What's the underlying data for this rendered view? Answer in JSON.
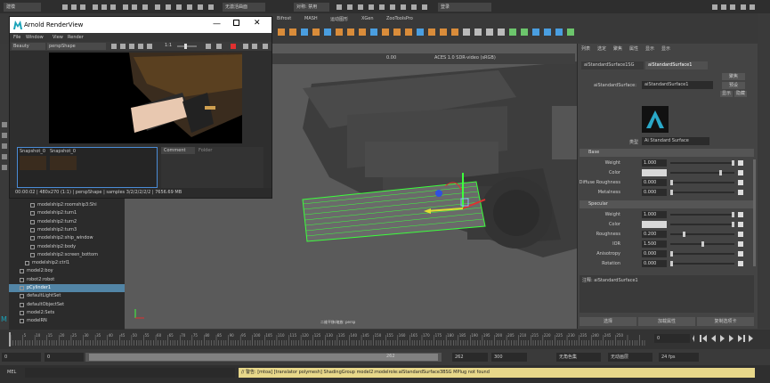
{
  "topbar": {
    "workspace": "建模",
    "no_live_surface": "无激活曲面",
    "symmetry": "对称: 禁用",
    "login": "登录"
  },
  "shelf_tabs": [
    "Bifrost",
    "MASH",
    "运动图形",
    "XGen",
    "ZooToolsPro"
  ],
  "render_view": {
    "title": "Arnold RenderView",
    "menu": [
      "File",
      "Window",
      "View",
      "Render"
    ],
    "aov": "Beauty",
    "camera": "perspShape",
    "ratio": "1:1",
    "exposure": "0.00",
    "color_space": "ACES 1.0 SDR-video (sRGB)",
    "snapshots": [
      "Snapshot_0",
      "Snapshot_0"
    ],
    "tabs": [
      "Comment",
      "Folder"
    ],
    "status": "00:00:02 | 480x270 (1:1) | perspShape | samples 3/2/2/2/2/2 | 7656.69 MB"
  },
  "viewport": {
    "camera_label": "二维平移/缩放: persp"
  },
  "outliner": {
    "items": [
      {
        "label": "modelship2:roomship3:Shi",
        "indent": 3,
        "selected": false
      },
      {
        "label": "modelship2:turn1",
        "indent": 3,
        "selected": false
      },
      {
        "label": "modelship2:turn2",
        "indent": 3,
        "selected": false
      },
      {
        "label": "modelship2:turn3",
        "indent": 3,
        "selected": false
      },
      {
        "label": "modelship2:ship_window",
        "indent": 3,
        "selected": false
      },
      {
        "label": "modelship2:body",
        "indent": 3,
        "selected": false
      },
      {
        "label": "modelship2:screen_bottom",
        "indent": 3,
        "selected": false
      },
      {
        "label": "modelship2:ctrl1",
        "indent": 2,
        "selected": false
      },
      {
        "label": "model2:boy",
        "indent": 1,
        "selected": false
      },
      {
        "label": "robot2:robot",
        "indent": 1,
        "selected": false
      },
      {
        "label": "pCylinder1",
        "indent": 1,
        "selected": true
      },
      {
        "label": "defaultLightSet",
        "indent": 1,
        "selected": false
      },
      {
        "label": "defaultObjectSet",
        "indent": 1,
        "selected": false
      },
      {
        "label": "model2:Sets",
        "indent": 1,
        "selected": false
      },
      {
        "label": "modelRN",
        "indent": 1,
        "selected": false
      }
    ]
  },
  "attr": {
    "top_tabs": [
      "列表",
      "选定",
      "聚焦",
      "属性",
      "显示",
      "显示"
    ],
    "node_tabs": [
      "aiStandardSurface1SG",
      "aiStandardSurface1"
    ],
    "node_label": "aiStandardSurface:",
    "node_name": "aiStandardSurface1",
    "focus_btn": "聚焦",
    "preset_btn": "预设",
    "show_btn": "显示",
    "hide_btn": "隐藏",
    "type_label": "类型",
    "type_value": "Ai Standard Surface",
    "base_section": "Base",
    "base_params": [
      {
        "label": "Weight",
        "value": "1.000",
        "level": 1.0
      },
      {
        "label": "Color",
        "value": "",
        "level": 0.8
      },
      {
        "label": "Diffuse Roughness",
        "value": "0.000",
        "level": 0.0
      },
      {
        "label": "Metalness",
        "value": "0.000",
        "level": 0.0
      }
    ],
    "spec_section": "Specular",
    "spec_params": [
      {
        "label": "Weight",
        "value": "1.000",
        "level": 1.0
      },
      {
        "label": "Color",
        "value": "",
        "level": 1.0
      },
      {
        "label": "Roughness",
        "value": "0.200",
        "level": 0.2
      },
      {
        "label": "IOR",
        "value": "1.500",
        "level": 0.5
      },
      {
        "label": "Anisotropy",
        "value": "0.000",
        "level": 0.0
      },
      {
        "label": "Rotation",
        "value": "0.000",
        "level": 0.0
      }
    ],
    "note_label": "注释: aiStandardSurface1",
    "bottom_buttons": [
      "选择",
      "加载属性",
      "复制选项卡"
    ]
  },
  "timeline": {
    "ticks": [
      "5",
      "10",
      "15",
      "20",
      "25",
      "30",
      "35",
      "40",
      "45",
      "50",
      "55",
      "60",
      "65",
      "70",
      "75",
      "80",
      "85",
      "90",
      "95",
      "100",
      "105",
      "110",
      "115",
      "120",
      "125",
      "130",
      "135",
      "140",
      "145",
      "150",
      "155",
      "160",
      "165",
      "170",
      "175",
      "180",
      "185",
      "190",
      "195",
      "200",
      "205",
      "210",
      "215",
      "220",
      "225",
      "230",
      "235",
      "240",
      "245",
      "250"
    ],
    "current_frame": "0",
    "range_start": "0",
    "range_inner_start": "0",
    "range_mid": "262",
    "range_end": "262",
    "range_outer_end": "300",
    "no_charset": "无角色集",
    "no_anim_layer": "无动画层",
    "fps": "24 fps"
  },
  "mel": {
    "label": "MEL",
    "warning": "// 警告: [mtoa] [translator polymesh] ShadingGroup model2:modelrole:aiStandardSurface3BSG MPlug not found"
  },
  "colors": {
    "accent": "#5285a6",
    "selection_green": "#3cff3c",
    "warning_bg": "#e8d88a"
  }
}
